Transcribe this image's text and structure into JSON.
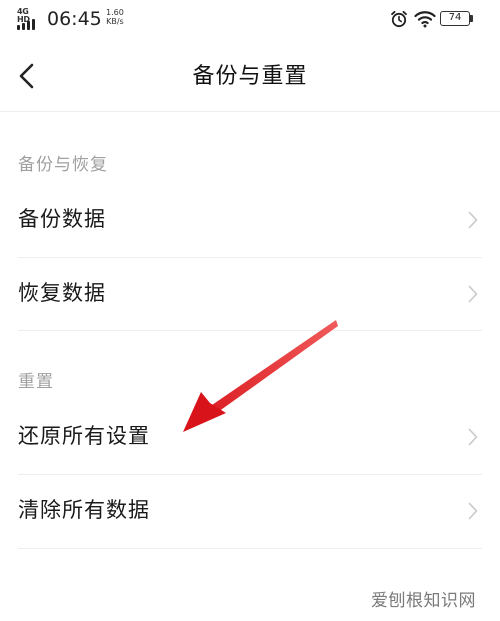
{
  "status_bar": {
    "network_type": "4G HD",
    "time": "06:45",
    "net_speed_value": "1.60",
    "net_speed_unit": "KB/s",
    "battery_level": "74",
    "icons": [
      "signal-icon",
      "alarm-icon",
      "wifi-icon",
      "battery-icon"
    ]
  },
  "header": {
    "title": "备份与重置",
    "back_icon": "chevron-left-icon"
  },
  "sections": [
    {
      "header": "备份与恢复",
      "items": [
        {
          "label": "备份数据",
          "has_chevron": true
        },
        {
          "label": "恢复数据",
          "has_chevron": true
        }
      ]
    },
    {
      "header": "重置",
      "items": [
        {
          "label": "还原所有设置",
          "has_chevron": true
        },
        {
          "label": "清除所有数据",
          "has_chevron": true
        }
      ]
    }
  ],
  "annotation": {
    "type": "arrow",
    "color": "#e0191b",
    "points_to": "还原所有设置"
  },
  "watermark": {
    "text": "爱刨根知识网"
  },
  "colors": {
    "background": "#ffffff",
    "primary_text": "#1a1a1a",
    "secondary_text": "#a0a0a0",
    "chevron": "#c8c8c8",
    "divider": "#efefef"
  }
}
